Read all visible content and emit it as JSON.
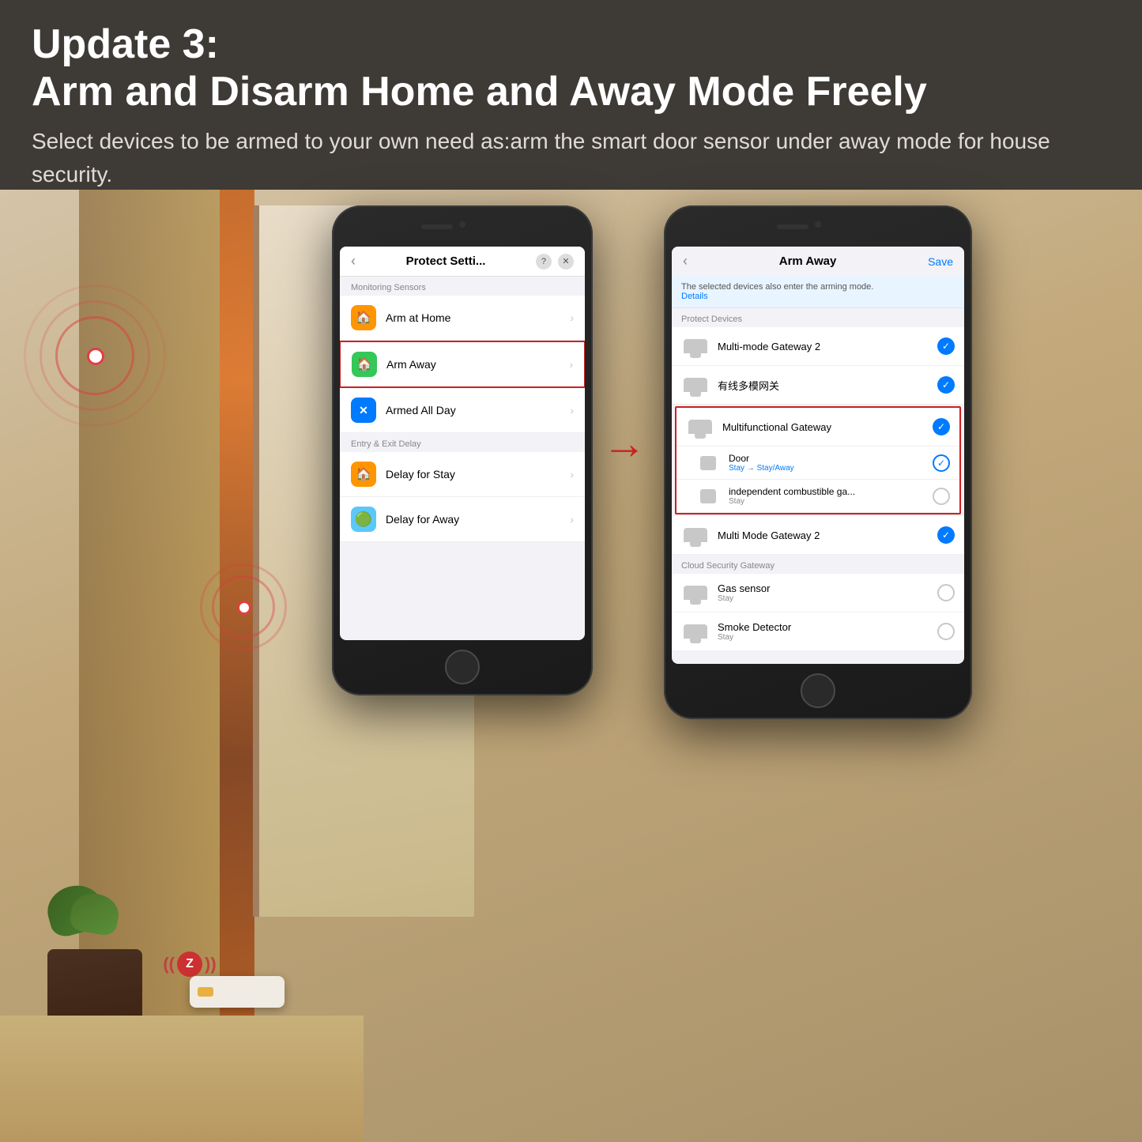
{
  "header": {
    "update_label": "Update 3:",
    "title": "Arm and Disarm Home and Away Mode Freely",
    "description": "Select devices to be armed to your own need as:arm the smart door sensor under away mode for house security."
  },
  "left_phone": {
    "screen_title": "Protect Setti...",
    "back_icon": "‹",
    "help_icon": "?",
    "close_icon": "✕",
    "section_monitoring": "Monitoring Sensors",
    "items": [
      {
        "label": "Arm at Home",
        "icon": "🏠",
        "icon_bg": "orange"
      },
      {
        "label": "Arm Away",
        "icon": "🏠",
        "icon_bg": "green",
        "highlighted": true
      },
      {
        "label": "Armed All Day",
        "icon": "✕",
        "icon_bg": "blue"
      }
    ],
    "section_delay": "Entry & Exit Delay",
    "delay_items": [
      {
        "label": "Delay for Stay",
        "icon": "🏠",
        "icon_bg": "orange"
      },
      {
        "label": "Delay for Away",
        "icon": "🟢",
        "icon_bg": "teal"
      }
    ]
  },
  "right_phone": {
    "back_icon": "‹",
    "screen_title": "Arm Away",
    "save_label": "Save",
    "notice": "The selected devices also enter the arming mode.",
    "notice_link": "Details",
    "section_protect": "Protect Devices",
    "devices": [
      {
        "name": "Multi-mode Gateway 2",
        "checked": true,
        "level": "top"
      },
      {
        "name": "有线多模网关",
        "checked": true,
        "level": "top"
      },
      {
        "name": "Multifunctional Gateway",
        "checked": true,
        "level": "top",
        "highlighted_group": true,
        "children": [
          {
            "name": "Door",
            "status": "Stay → Stay/Away",
            "checked": true
          },
          {
            "name": "independent combustible ga...",
            "status": "Stay",
            "checked": false
          }
        ]
      },
      {
        "name": "Multi Mode Gateway 2",
        "checked": true,
        "level": "top"
      }
    ],
    "section_cloud": "Cloud Security Gateway",
    "cloud_devices": [
      {
        "name": "Gas sensor",
        "status": "Stay",
        "checked": false
      },
      {
        "name": "Smoke Detector",
        "status": "Stay",
        "checked": false
      }
    ]
  },
  "arrow": "→",
  "zigbee": {
    "left_wave": "(((",
    "logo": "Z",
    "right_wave": ")))"
  }
}
